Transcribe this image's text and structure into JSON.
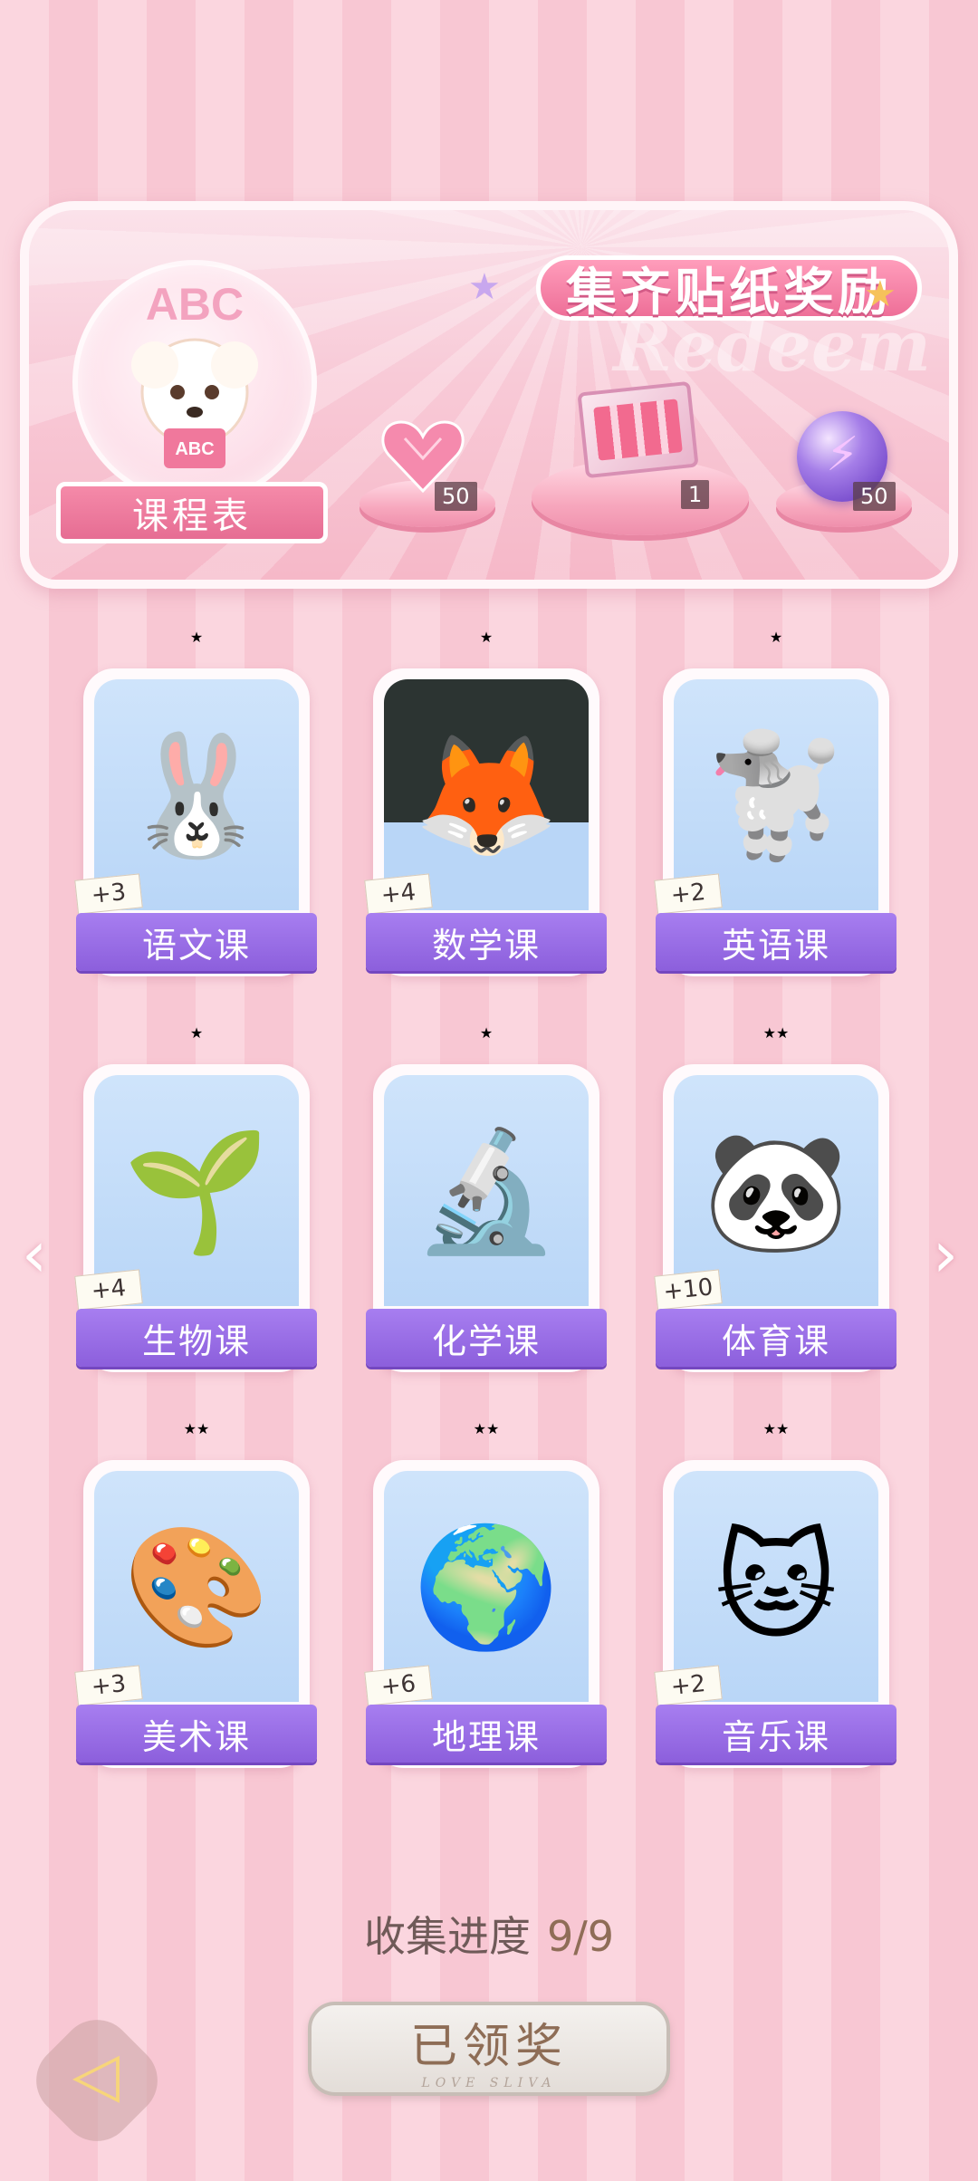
{
  "colors": {
    "accent_pink": "#ee6f98",
    "label_purple": "#9a6ee6",
    "star_gold": "#f5c244"
  },
  "banner": {
    "title": "集齐贴纸奖励",
    "watermark": "Redeem",
    "schedule_label": "课程表",
    "schedule_art_text": "ABC",
    "rewards": [
      {
        "icon": "pink-heart-gem",
        "count": "50"
      },
      {
        "icon": "gift-box",
        "count": "1"
      },
      {
        "icon": "purple-lightning-orb",
        "count": "50"
      }
    ]
  },
  "cards": [
    {
      "label": "语文课",
      "bonus": "+3",
      "stars": "★",
      "icon": "rabbit-calligraphy",
      "glyph": "🐰"
    },
    {
      "label": "数学课",
      "bonus": "+4",
      "stars": "★",
      "icon": "fox-blackboard",
      "glyph": "🦊"
    },
    {
      "label": "英语课",
      "bonus": "+2",
      "stars": "★",
      "icon": "poodle-abc-book",
      "glyph": "🐩"
    },
    {
      "label": "生物课",
      "bonus": "+4",
      "stars": "★",
      "icon": "sprout-sun",
      "glyph": "🌱"
    },
    {
      "label": "化学课",
      "bonus": "",
      "stars": "★",
      "icon": "microscope",
      "glyph": "🔬"
    },
    {
      "label": "体育课",
      "bonus": "+10",
      "stars": "★★",
      "icon": "panda-pingpong",
      "glyph": "🐼"
    },
    {
      "label": "美术课",
      "bonus": "+3",
      "stars": "★★",
      "icon": "cat-painter",
      "glyph": "🎨"
    },
    {
      "label": "地理课",
      "bonus": "+6",
      "stars": "★★",
      "icon": "globe",
      "glyph": "🌍"
    },
    {
      "label": "音乐课",
      "bonus": "+2",
      "stars": "★★",
      "icon": "cat-keyboard",
      "glyph": "🐱"
    }
  ],
  "nav": {
    "prev": "‹",
    "next": "›"
  },
  "progress": {
    "label": "收集进度",
    "value": "9/9"
  },
  "claim_button": {
    "label": "已领奖",
    "sub": "LOVE SLIVA"
  },
  "back_button": {
    "icon": "back-arrow-icon",
    "glyph": "◁"
  }
}
